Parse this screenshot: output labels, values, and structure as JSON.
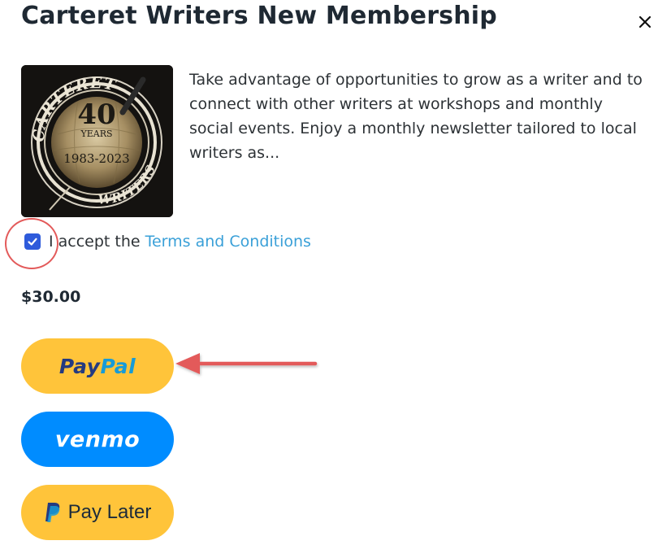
{
  "header": {
    "title": "Carteret Writers New Membership",
    "close_icon": "close-icon"
  },
  "product": {
    "logo": {
      "top_text": "CARTERET",
      "bottom_text": "WRITERS",
      "number": "40",
      "years_label": "YEARS",
      "range": "1983-2023"
    },
    "description": "Take advantage of opportunities to grow as a writer and to connect with other writers at workshops and monthly social events. Enjoy a monthly newsletter tailored to local writers as..."
  },
  "terms": {
    "checked": true,
    "label": "I accept the",
    "link_text": "Terms and Conditions"
  },
  "price": "$30.00",
  "payment_buttons": {
    "paypal": {
      "pay": "Pay",
      "pal": "Pal"
    },
    "venmo": {
      "label": "venmo"
    },
    "pay_later": {
      "label": "Pay Later",
      "icon": "paypal-p-icon"
    }
  },
  "colors": {
    "title": "#1f2933",
    "link": "#3aa0d8",
    "checkbox": "#2e5bdb",
    "paypal_yellow": "#ffc43a",
    "venmo_blue": "#008cff",
    "annotation_red": "#e35a5a"
  }
}
